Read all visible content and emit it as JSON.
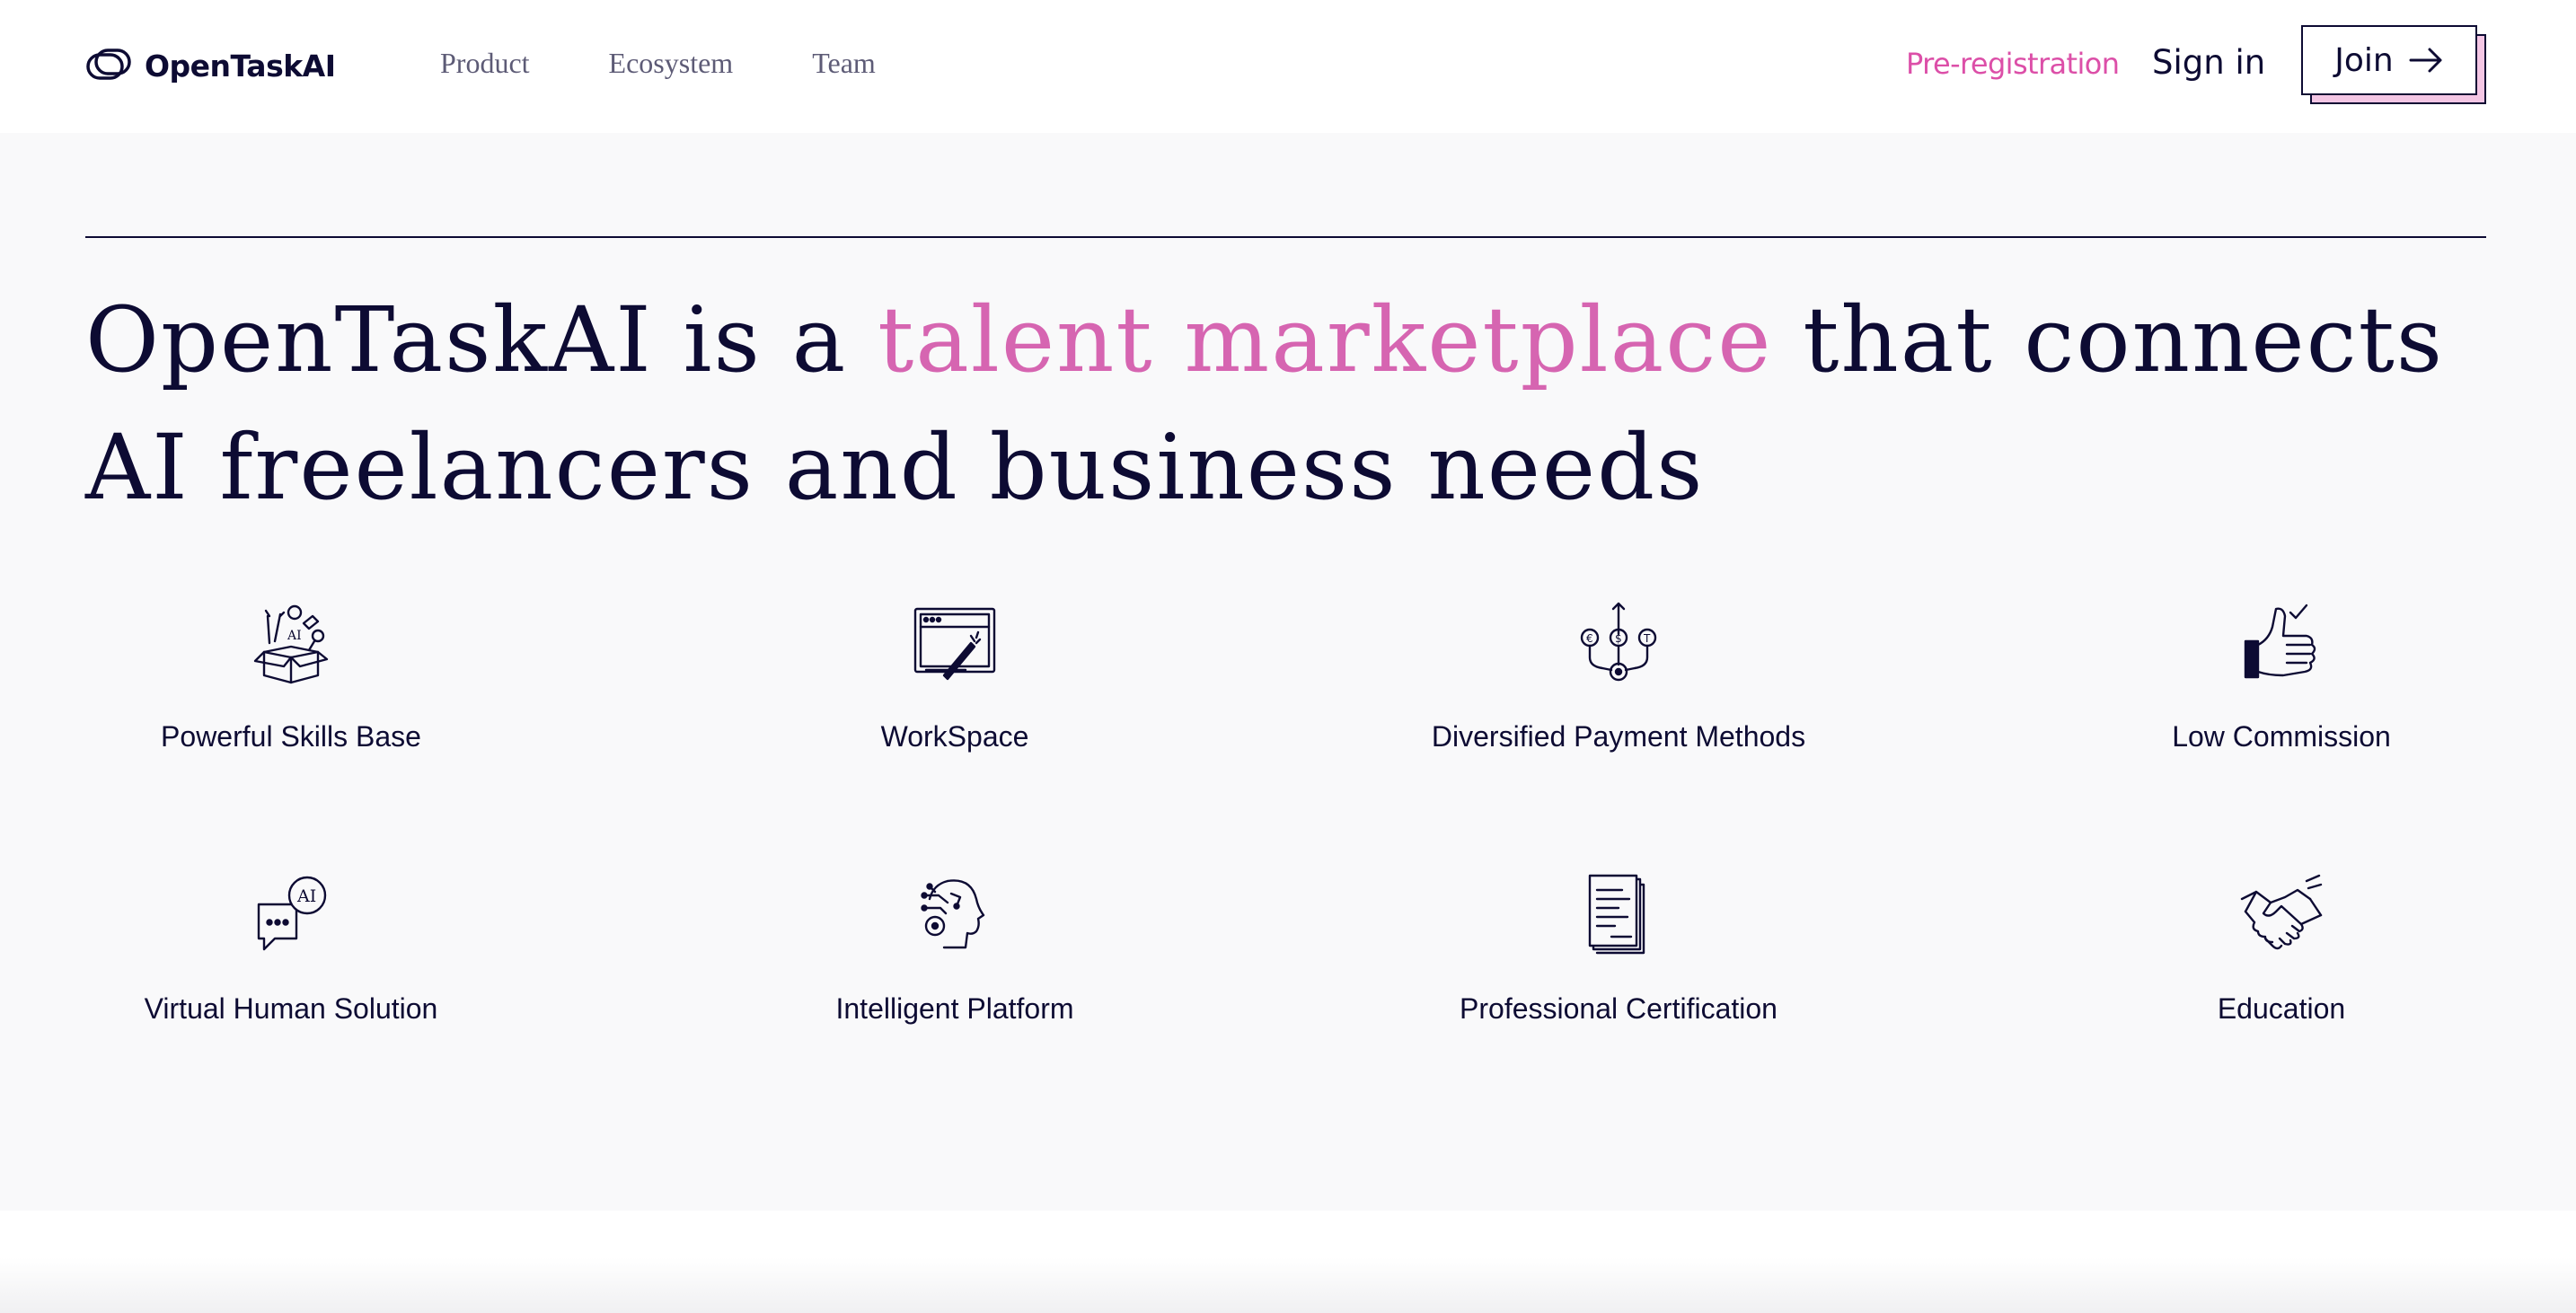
{
  "header": {
    "brand": "OpenTaskAI",
    "nav": [
      "Product",
      "Ecosystem",
      "Team"
    ],
    "preregistration": "Pre-registration",
    "sign_in": "Sign in",
    "join": "Join"
  },
  "hero": {
    "lead": "OpenTaskAI is a ",
    "accent": "talent marketplace",
    "tail": " that connects AI freelancers and business needs"
  },
  "features": [
    {
      "label": "Powerful Skills Base",
      "icon": "skills-box-icon"
    },
    {
      "label": "WorkSpace",
      "icon": "workspace-window-icon"
    },
    {
      "label": "Diversified Payment Methods",
      "icon": "payment-currencies-icon"
    },
    {
      "label": "Low Commission",
      "icon": "thumbs-up-icon"
    },
    {
      "label": "Virtual Human Solution",
      "icon": "ai-chat-bubble-icon"
    },
    {
      "label": "Intelligent Platform",
      "icon": "ai-head-icon"
    },
    {
      "label": "Professional Certification",
      "icon": "document-stack-icon"
    },
    {
      "label": "Education",
      "icon": "handshake-icon"
    }
  ],
  "colors": {
    "ink": "#0d0b33",
    "accent_pink": "#dc4fa8",
    "headline_pink": "#d665b1",
    "section_bg": "#f9f9fa",
    "join_shadow": "#f4c6e4"
  }
}
